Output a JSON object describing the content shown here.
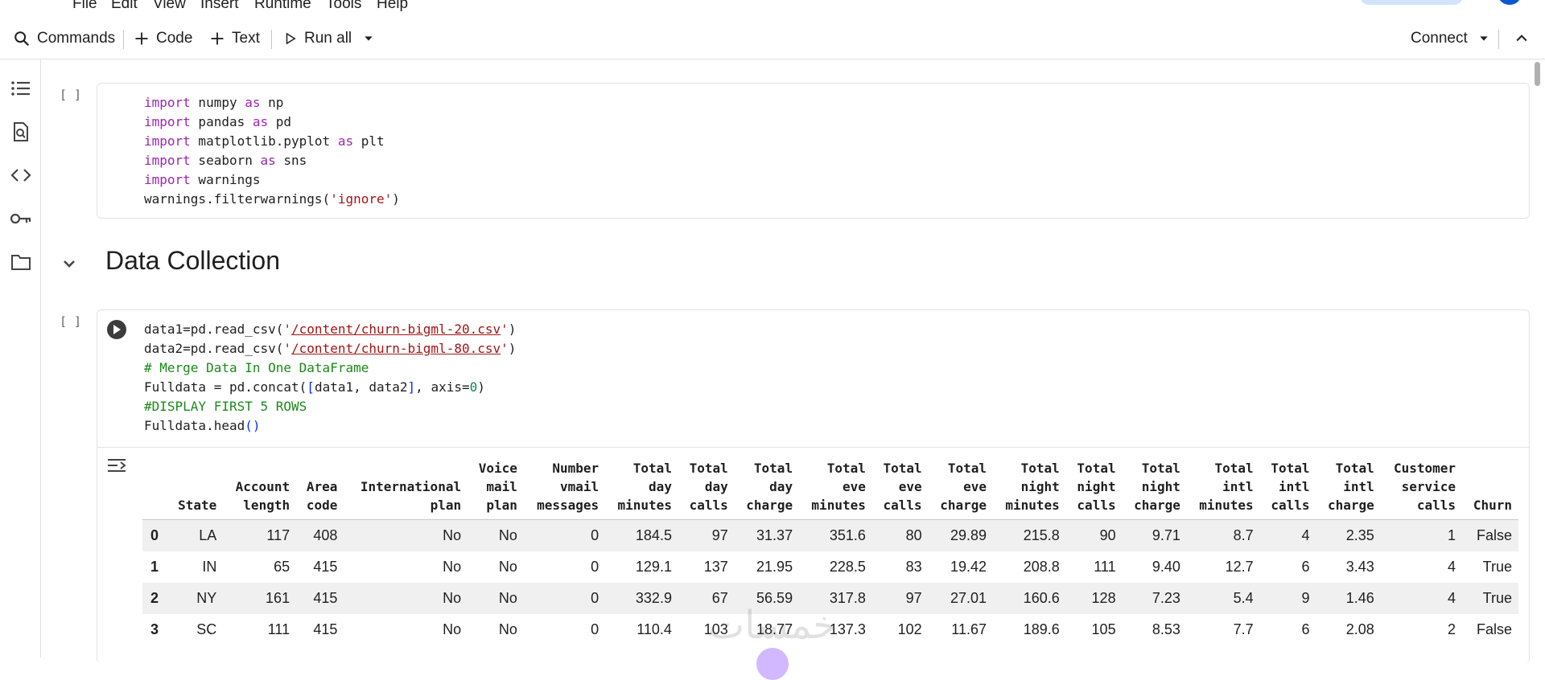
{
  "menu": {
    "items": [
      "File",
      "Edit",
      "View",
      "Insert",
      "Runtime",
      "Tools",
      "Help"
    ]
  },
  "toolbar": {
    "commands_label": "Commands",
    "code_label": "Code",
    "text_label": "Text",
    "run_all_label": "Run all",
    "connect_label": "Connect"
  },
  "sidebar": {
    "icons": [
      "table-of-contents-icon",
      "find-replace-icon",
      "code-snippets-icon",
      "secrets-key-icon",
      "files-folder-icon"
    ]
  },
  "cell1": {
    "bracket": "[ ]",
    "lines": [
      {
        "kw": "import",
        "rest": " numpy ",
        "kw2": "as",
        "rest2": " np"
      },
      {
        "kw": "import",
        "rest": " pandas ",
        "kw2": "as",
        "rest2": " pd"
      },
      {
        "kw": "import",
        "rest": " matplotlib.pyplot ",
        "kw2": "as",
        "rest2": " plt"
      },
      {
        "kw": "import",
        "rest": " seaborn ",
        "kw2": "as",
        "rest2": " sns"
      },
      {
        "kw": "import",
        "rest": " warnings",
        "kw2": "",
        "rest2": ""
      }
    ],
    "last_line_prefix": "warnings.filterwarnings(",
    "last_line_string": "'ignore'",
    "last_line_suffix": ")"
  },
  "section": {
    "title": "Data Collection"
  },
  "cell2": {
    "bracket": "[ ]",
    "line1_prefix": "data1=pd.read_csv(",
    "line1_q1": "'",
    "line1_path": "/content/churn-bigml-20.csv",
    "line1_q2": "'",
    "line1_suffix": ")",
    "line2_prefix": "data2=pd.read_csv(",
    "line2_q1": "'",
    "line2_path": "/content/churn-bigml-80.csv",
    "line2_q2": "'",
    "line2_suffix": ")",
    "comment1": "# Merge Data In One DataFrame",
    "line4_a": "Fulldata = pd.concat(",
    "line4_b": "[",
    "line4_c": "data1, data2",
    "line4_d": "]",
    "line4_e": ", axis=",
    "line4_f": "0",
    "line4_g": ")",
    "comment2": "#DISPLAY FIRST 5 ROWS",
    "line6_a": "Fulldata.head",
    "line6_b": "()"
  },
  "dataframe": {
    "columns": [
      "",
      "State",
      "Account\nlength",
      "Area\ncode",
      "International\nplan",
      "Voice\nmail\nplan",
      "Number\nvmail\nmessages",
      "Total\nday\nminutes",
      "Total\nday\ncalls",
      "Total\nday\ncharge",
      "Total\neve\nminutes",
      "Total\neve\ncalls",
      "Total\neve\ncharge",
      "Total\nnight\nminutes",
      "Total\nnight\ncalls",
      "Total\nnight\ncharge",
      "Total\nintl\nminutes",
      "Total\nintl\ncalls",
      "Total\nintl\ncharge",
      "Customer\nservice\ncalls",
      "Churn"
    ],
    "rows": [
      [
        "0",
        "LA",
        "117",
        "408",
        "No",
        "No",
        "0",
        "184.5",
        "97",
        "31.37",
        "351.6",
        "80",
        "29.89",
        "215.8",
        "90",
        "9.71",
        "8.7",
        "4",
        "2.35",
        "1",
        "False"
      ],
      [
        "1",
        "IN",
        "65",
        "415",
        "No",
        "No",
        "0",
        "129.1",
        "137",
        "21.95",
        "228.5",
        "83",
        "19.42",
        "208.8",
        "111",
        "9.40",
        "12.7",
        "6",
        "3.43",
        "4",
        "True"
      ],
      [
        "2",
        "NY",
        "161",
        "415",
        "No",
        "No",
        "0",
        "332.9",
        "67",
        "56.59",
        "317.8",
        "97",
        "27.01",
        "160.6",
        "128",
        "7.23",
        "5.4",
        "9",
        "1.46",
        "4",
        "True"
      ],
      [
        "3",
        "SC",
        "111",
        "415",
        "No",
        "No",
        "0",
        "110.4",
        "103",
        "18.77",
        "137.3",
        "102",
        "11.67",
        "189.6",
        "105",
        "8.53",
        "7.7",
        "6",
        "2.08",
        "2",
        "False"
      ]
    ]
  },
  "watermark": {
    "text": "خمسات"
  }
}
